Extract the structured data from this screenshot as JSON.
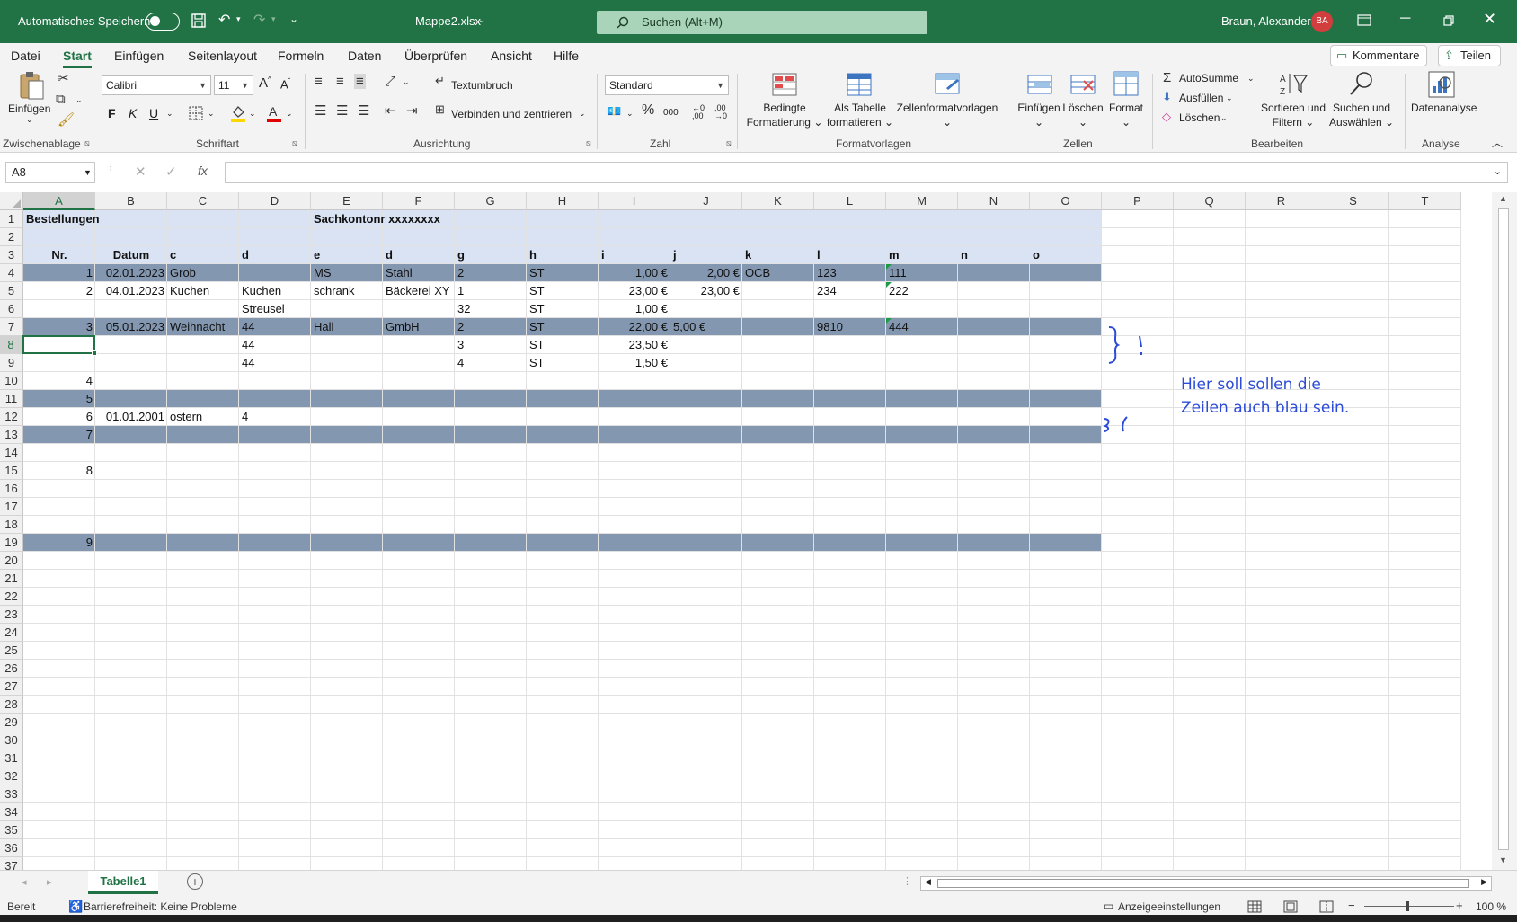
{
  "titlebar": {
    "autosave_label": "Automatisches Speichern",
    "filename": "Mappe2.xlsx",
    "search_placeholder": "Suchen (Alt+M)",
    "user": "Braun, Alexander",
    "initials": "BA"
  },
  "menu": {
    "items": [
      "Datei",
      "Start",
      "Einfügen",
      "Seitenlayout",
      "Formeln",
      "Daten",
      "Überprüfen",
      "Ansicht",
      "Hilfe"
    ],
    "comments": "Kommentare",
    "share": "Teilen"
  },
  "ribbon": {
    "paste": "Einfügen",
    "group_clipboard": "Zwischenablage",
    "font_name": "Calibri",
    "font_size": "11",
    "bold": "F",
    "italic": "K",
    "underline": "U",
    "group_font": "Schriftart",
    "wrap_text": "Textumbruch",
    "merge_center": "Verbinden und zentrieren",
    "group_alignment": "Ausrichtung",
    "number_format": "Standard",
    "group_number": "Zahl",
    "cond_format_1": "Bedingte",
    "cond_format_2": "Formatierung",
    "as_table_1": "Als Tabelle",
    "as_table_2": "formatieren",
    "cell_styles": "Zellenformatvorlagen",
    "group_styles": "Formatvorlagen",
    "insert": "Einfügen",
    "delete": "Löschen",
    "format": "Format",
    "group_cells": "Zellen",
    "autosum": "AutoSumme",
    "fill": "Ausfüllen",
    "clear": "Löschen",
    "sort_1": "Sortieren und",
    "sort_2": "Filtern",
    "find_1": "Suchen und",
    "find_2": "Auswählen",
    "group_editing": "Bearbeiten",
    "data_analysis": "Datenanalyse",
    "group_analysis": "Analyse"
  },
  "formula_bar": {
    "name_box": "A8",
    "formula": ""
  },
  "columns": [
    "A",
    "B",
    "C",
    "D",
    "E",
    "F",
    "G",
    "H",
    "I",
    "J",
    "K",
    "L",
    "M",
    "N",
    "O",
    "P",
    "Q",
    "R",
    "S",
    "T"
  ],
  "rows": [
    "1",
    "2",
    "3",
    "4",
    "5",
    "6",
    "7",
    "8",
    "9",
    "10",
    "11",
    "12",
    "13",
    "14",
    "15",
    "16",
    "17",
    "18",
    "19",
    "20",
    "21",
    "22",
    "23",
    "24",
    "25",
    "26",
    "27",
    "28",
    "29",
    "30",
    "31",
    "32",
    "33",
    "34",
    "35",
    "36",
    "37"
  ],
  "cells": {
    "r1": {
      "A": "Bestellungen",
      "E": "Sachkontonr xxxxxxxx"
    },
    "r3": {
      "A": "Nr.",
      "B": "Datum",
      "C": "c",
      "D": "d",
      "E": "e",
      "F": "d",
      "G": "g",
      "H": "h",
      "I": "i",
      "J": "j",
      "K": "k",
      "L": "l",
      "M": "m",
      "N": "n",
      "O": "o"
    },
    "r4": {
      "A": "1",
      "B": "02.01.2023",
      "C": "Grob",
      "E": "MS",
      "F": "Stahl",
      "G": "2",
      "H": "ST",
      "I": "1,00 €",
      "J": "2,00 €",
      "K": "OCB",
      "L": "123",
      "M": "111"
    },
    "r5": {
      "A": "2",
      "B": "04.01.2023",
      "C": "Kuchen",
      "D": "Kuchen",
      "E": "schrank",
      "F": "Bäckerei XY",
      "G": "1",
      "H": "ST",
      "I": "23,00 €",
      "J": "23,00 €",
      "L": "234",
      "M": "222"
    },
    "r6": {
      "D": "Streusel",
      "G": "32",
      "H": "ST",
      "I": "1,00 €"
    },
    "r7": {
      "A": "3",
      "B": "05.01.2023",
      "C": "Weihnacht",
      "D": "44",
      "E": "Hall",
      "F": "GmbH",
      "G": "2",
      "H": "ST",
      "I": "22,00 €",
      "J": "5,00 €",
      "L": "9810",
      "M": "444"
    },
    "r8": {
      "D": "44",
      "G": "3",
      "H": "ST",
      "I": "23,50 €"
    },
    "r9": {
      "D": "44",
      "G": "4",
      "H": "ST",
      "I": "1,50 €"
    },
    "r10": {
      "A": "4"
    },
    "r11": {
      "A": "5"
    },
    "r12": {
      "A": "6",
      "B": "01.01.2001",
      "C": "ostern",
      "D": "4"
    },
    "r13": {
      "A": "7"
    },
    "r15": {
      "A": "8"
    },
    "r19": {
      "A": "9"
    }
  },
  "annotation": "Hier soll sollen die Zeilen auch blau sein.",
  "sheet_tab": "Tabelle1",
  "status": {
    "ready": "Bereit",
    "accessibility": "Barrierefreiheit: Keine Probleme",
    "display_settings": "Anzeigeeinstellungen",
    "zoom": "100 %"
  },
  "colors": {
    "brand": "#217346",
    "band_light": "#dae3f3",
    "band_dark": "#8497b0",
    "annotation": "#2b4bd8"
  }
}
